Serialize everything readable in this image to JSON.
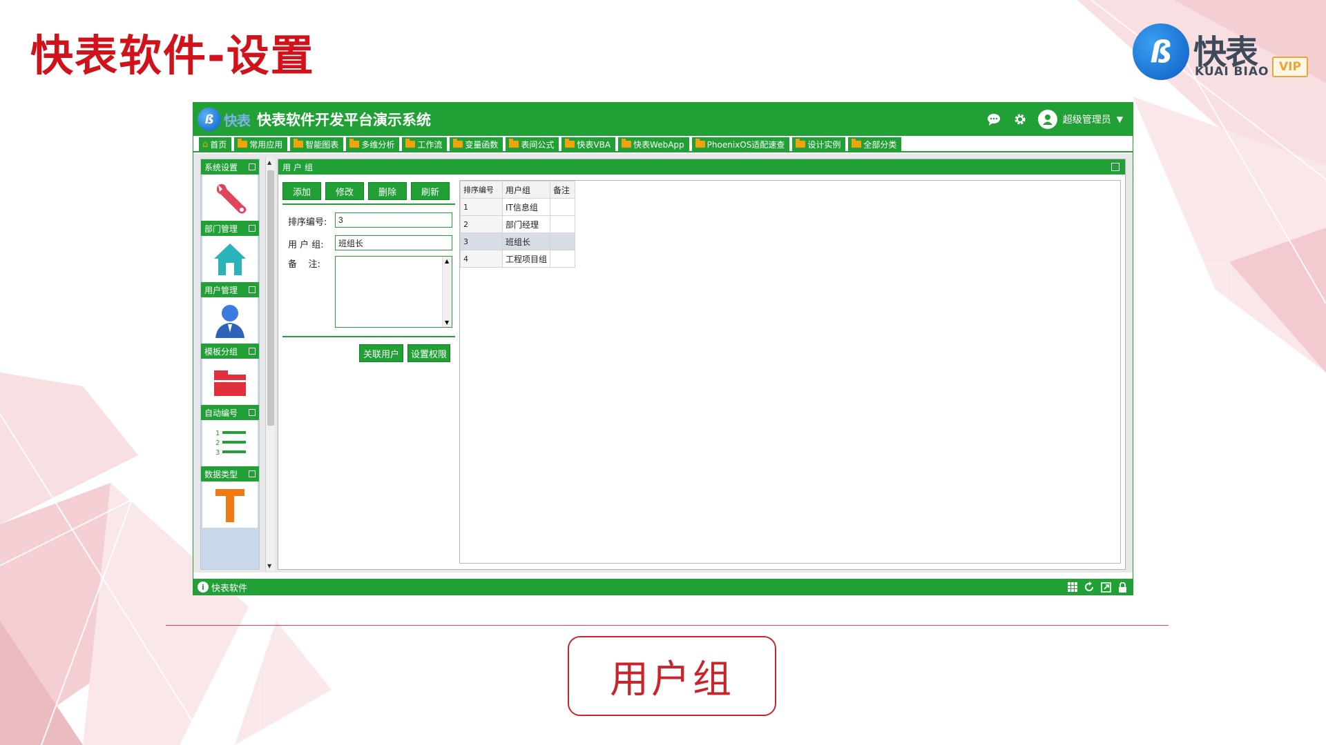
{
  "slide": {
    "title": "快表软件-设置",
    "caption": "用户组"
  },
  "brand": {
    "mark": "ß",
    "name": "快表",
    "sub": "KUAI BIAO",
    "vip": "VIP"
  },
  "colors": {
    "accent_green": "#21a035",
    "title_red": "#d0121b",
    "folder_orange": "#f2a20c"
  },
  "app": {
    "logo_mark": "ß",
    "logo_text": "快表",
    "title": "快表软件开发平台演示系统",
    "user_name": "超级管理员",
    "icons": [
      "chat-icon",
      "gear-icon",
      "user-avatar-icon",
      "chevron-down-icon"
    ]
  },
  "tabs": [
    {
      "label": "首页",
      "icon": "home-icon"
    },
    {
      "label": "常用应用",
      "icon": "folder-icon"
    },
    {
      "label": "智能图表",
      "icon": "folder-icon"
    },
    {
      "label": "多维分析",
      "icon": "folder-icon"
    },
    {
      "label": "工作流",
      "icon": "folder-icon"
    },
    {
      "label": "变量函数",
      "icon": "folder-icon"
    },
    {
      "label": "表间公式",
      "icon": "folder-icon"
    },
    {
      "label": "快表VBA",
      "icon": "folder-icon"
    },
    {
      "label": "快表WebApp",
      "icon": "folder-icon"
    },
    {
      "label": "PhoenixOS适配速查",
      "icon": "folder-icon"
    },
    {
      "label": "设计实例",
      "icon": "folder-icon"
    },
    {
      "label": "全部分类",
      "icon": "folder-icon"
    }
  ],
  "sidebar": {
    "items": [
      {
        "label": "系统设置",
        "icon": "wrench-icon"
      },
      {
        "label": "部门管理",
        "icon": "house-icon"
      },
      {
        "label": "用户管理",
        "icon": "person-icon"
      },
      {
        "label": "模板分组",
        "icon": "folder-red-icon"
      },
      {
        "label": "自动编号",
        "icon": "numbered-list-icon"
      },
      {
        "label": "数据类型",
        "icon": "letter-t-icon"
      }
    ]
  },
  "panel": {
    "title": "用户组",
    "buttons": {
      "add": "添加",
      "edit": "修改",
      "delete": "删除",
      "refresh": "刷新"
    },
    "form": {
      "sort_label": "排序编号:",
      "sort_value": "3",
      "group_label": "用 户 组:",
      "group_value": "班组长",
      "note_label": "备    注:",
      "note_value": ""
    },
    "bottom_buttons": {
      "link_users": "关联用户",
      "set_permissions": "设置权限"
    }
  },
  "grid": {
    "headers": [
      "排序编号",
      "用户组",
      "备注"
    ],
    "rows": [
      [
        "1",
        "IT信息组",
        ""
      ],
      [
        "2",
        "部门经理",
        ""
      ],
      [
        "3",
        "班组长",
        ""
      ],
      [
        "4",
        "工程项目组",
        ""
      ]
    ],
    "selected_row": 2
  },
  "status": {
    "text": "快表软件",
    "icons": [
      "grid-icon",
      "refresh-icon",
      "expand-icon",
      "lock-icon"
    ]
  }
}
